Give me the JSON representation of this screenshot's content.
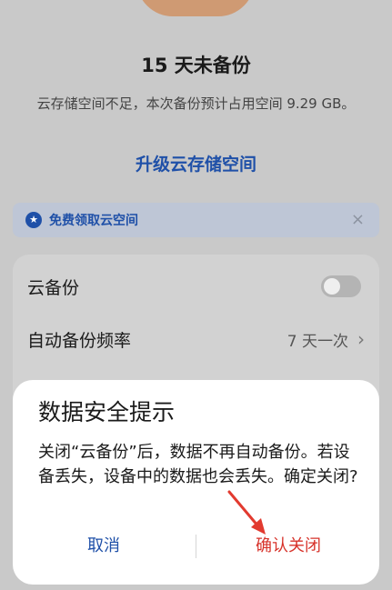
{
  "status": {
    "headline": "15 天未备份",
    "description": "云存储空间不足，本次备份预计占用空间 9.29 GB。",
    "upgrade_link": "升级云存储空间"
  },
  "banner": {
    "text": "免费领取云空间",
    "icon": "star-badge-icon",
    "close": "×"
  },
  "settings": {
    "cloud_backup_label": "云备份",
    "cloud_backup_enabled": false,
    "frequency_label": "自动备份频率",
    "frequency_value": "7 天一次",
    "chevron": "›"
  },
  "dialog": {
    "title": "数据安全提示",
    "body": "关闭“云备份”后，数据不再自动备份。若设备丢失，设备中的数据也会丢失。确定关闭?",
    "cancel_label": "取消",
    "confirm_label": "确认关闭"
  },
  "colors": {
    "accent": "#1f50a8",
    "danger": "#d7322a",
    "annotation_arrow": "#e23a2f"
  }
}
